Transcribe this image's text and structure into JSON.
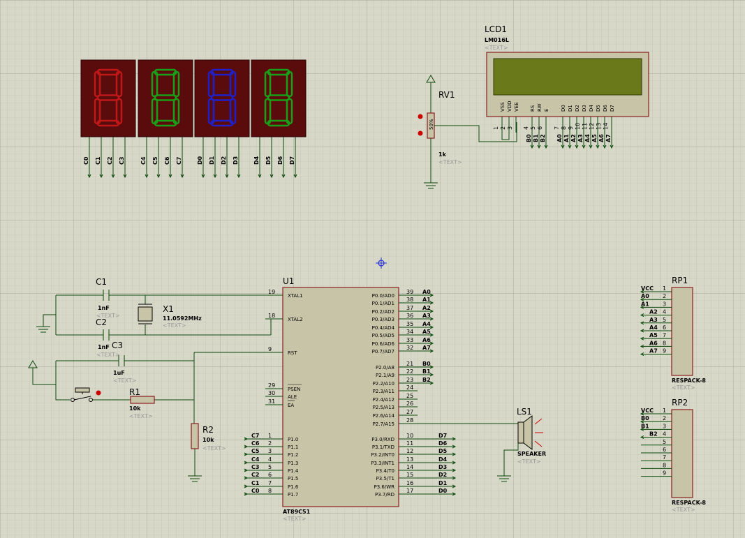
{
  "seven_seg": {
    "digits": [
      {
        "color": "#c01818",
        "pins": [
          "C0",
          "C1",
          "C2",
          "C3"
        ]
      },
      {
        "color": "#18a018",
        "pins": [
          "C4",
          "C5",
          "C6",
          "C7"
        ]
      },
      {
        "color": "#2020c8",
        "pins": [
          "D0",
          "D1",
          "D2",
          "D3"
        ]
      },
      {
        "color": "#18a018",
        "pins": [
          "D4",
          "D5",
          "D6",
          "D7"
        ]
      }
    ]
  },
  "lcd": {
    "ref": "LCD1",
    "model": "LM016L",
    "text_placeholder": "<TEXT>",
    "pin_labels": [
      "VSS",
      "VDD",
      "VEE",
      "RS",
      "RW",
      "E",
      "D0",
      "D1",
      "D2",
      "D3",
      "D4",
      "D5",
      "D6",
      "D7"
    ],
    "pin_numbers": [
      "1",
      "2",
      "3",
      "4",
      "5",
      "6",
      "7",
      "8",
      "9",
      "10",
      "11",
      "12",
      "13",
      "14"
    ],
    "nets": [
      "B0",
      "B1",
      "B2",
      "A0",
      "A1",
      "A2",
      "A3",
      "A4",
      "A5",
      "A6",
      "A7"
    ]
  },
  "rv1": {
    "ref": "RV1",
    "value": "1k",
    "text_placeholder": "<TEXT>",
    "pct": "50%"
  },
  "u1": {
    "ref": "U1",
    "model": "AT89C51",
    "text_placeholder": "<TEXT>",
    "left_pins": [
      {
        "num": "19",
        "name": "XTAL1"
      },
      {
        "num": "18",
        "name": "XTAL2"
      },
      {
        "num": "9",
        "name": "RST"
      },
      {
        "num": "29",
        "name": "PSEN"
      },
      {
        "num": "30",
        "name": "ALE"
      },
      {
        "num": "31",
        "name": "EA"
      },
      {
        "num": "1",
        "name": "P1.0",
        "net": "C7"
      },
      {
        "num": "2",
        "name": "P1.1",
        "net": "C6"
      },
      {
        "num": "3",
        "name": "P1.2",
        "net": "C5"
      },
      {
        "num": "4",
        "name": "P1.3",
        "net": "C4"
      },
      {
        "num": "5",
        "name": "P1.4",
        "net": "C3"
      },
      {
        "num": "6",
        "name": "P1.5",
        "net": "C2"
      },
      {
        "num": "7",
        "name": "P1.6",
        "net": "C1"
      },
      {
        "num": "8",
        "name": "P1.7",
        "net": "C0"
      }
    ],
    "right_pins": [
      {
        "num": "39",
        "name": "P0.0/AD0",
        "net": "A0"
      },
      {
        "num": "38",
        "name": "P0.1/AD1",
        "net": "A1"
      },
      {
        "num": "37",
        "name": "P0.2/AD2",
        "net": "A2"
      },
      {
        "num": "36",
        "name": "P0.3/AD3",
        "net": "A3"
      },
      {
        "num": "35",
        "name": "P0.4/AD4",
        "net": "A4"
      },
      {
        "num": "34",
        "name": "P0.5/AD5",
        "net": "A5"
      },
      {
        "num": "33",
        "name": "P0.6/AD6",
        "net": "A6"
      },
      {
        "num": "32",
        "name": "P0.7/AD7",
        "net": "A7"
      },
      {
        "num": "21",
        "name": "P2.0/A8",
        "net": "B0"
      },
      {
        "num": "22",
        "name": "P2.1/A9",
        "net": "B1"
      },
      {
        "num": "23",
        "name": "P2.2/A10",
        "net": "B2"
      },
      {
        "num": "24",
        "name": "P2.3/A11"
      },
      {
        "num": "25",
        "name": "P2.4/A12"
      },
      {
        "num": "26",
        "name": "P2.5/A13"
      },
      {
        "num": "27",
        "name": "P2.6/A14"
      },
      {
        "num": "28",
        "name": "P2.7/A15"
      },
      {
        "num": "10",
        "name": "P3.0/RXD",
        "net": "D7"
      },
      {
        "num": "11",
        "name": "P3.1/TXD",
        "net": "D6"
      },
      {
        "num": "12",
        "name": "P3.2/INT0",
        "net": "D5"
      },
      {
        "num": "13",
        "name": "P3.3/INT1",
        "net": "D4"
      },
      {
        "num": "14",
        "name": "P3.4/T0",
        "net": "D3"
      },
      {
        "num": "15",
        "name": "P3.5/T1",
        "net": "D2"
      },
      {
        "num": "16",
        "name": "P3.6/WR",
        "net": "D1"
      },
      {
        "num": "17",
        "name": "P3.7/RD",
        "net": "D0"
      }
    ]
  },
  "c1": {
    "ref": "C1",
    "value": "1nF",
    "text_placeholder": "<TEXT>"
  },
  "c2": {
    "ref": "C2",
    "value": "1nF",
    "text_placeholder": "<TEXT>"
  },
  "c3": {
    "ref": "C3",
    "value": "1uF",
    "text_placeholder": "<TEXT>"
  },
  "x1": {
    "ref": "X1",
    "value": "11.0592MHz",
    "text_placeholder": "<TEXT>"
  },
  "r1": {
    "ref": "R1",
    "value": "10k",
    "text_placeholder": "<TEXT>"
  },
  "r2": {
    "ref": "R2",
    "value": "10k",
    "text_placeholder": "<TEXT>"
  },
  "ls1": {
    "ref": "LS1",
    "model": "SPEAKER",
    "text_placeholder": "<TEXT>"
  },
  "rp1": {
    "ref": "RP1",
    "model": "RESPACK-8",
    "text_placeholder": "<TEXT>",
    "pins": [
      {
        "num": "1",
        "net": "VCC"
      },
      {
        "num": "2",
        "net": "A0"
      },
      {
        "num": "3",
        "net": "A1"
      },
      {
        "num": "4",
        "net": "A2"
      },
      {
        "num": "5",
        "net": "A3"
      },
      {
        "num": "6",
        "net": "A4"
      },
      {
        "num": "7",
        "net": "A5"
      },
      {
        "num": "8",
        "net": "A6"
      },
      {
        "num": "9",
        "net": "A7"
      }
    ]
  },
  "rp2": {
    "ref": "RP2",
    "model": "RESPACK-8",
    "text_placeholder": "<TEXT>",
    "pins": [
      {
        "num": "1",
        "net": "VCC"
      },
      {
        "num": "2",
        "net": "B0"
      },
      {
        "num": "3",
        "net": "B1"
      },
      {
        "num": "4",
        "net": "B2"
      },
      {
        "num": "5",
        "net": ""
      },
      {
        "num": "6",
        "net": ""
      },
      {
        "num": "7",
        "net": ""
      },
      {
        "num": "8",
        "net": ""
      },
      {
        "num": "9",
        "net": ""
      }
    ]
  }
}
